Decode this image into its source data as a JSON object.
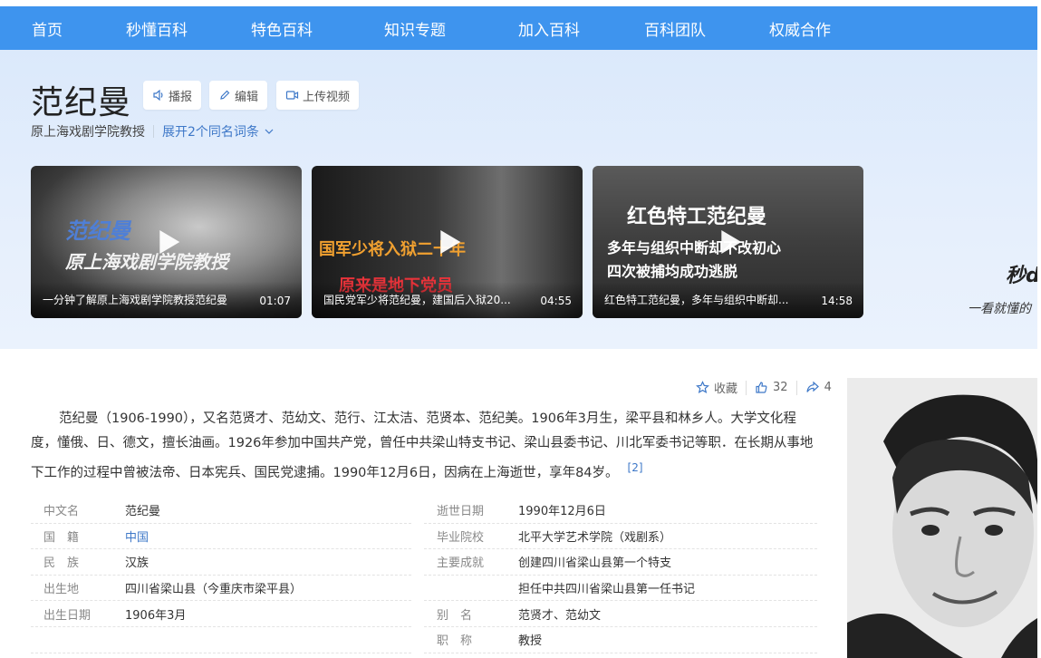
{
  "nav": {
    "items": [
      "首页",
      "秒懂百科",
      "特色百科",
      "知识专题",
      "加入百科",
      "百科团队",
      "权威合作"
    ]
  },
  "header": {
    "title": "范纪曼",
    "actions": {
      "broadcast": "播报",
      "edit": "编辑",
      "upload_video": "上传视频"
    },
    "subtitle": "原上海戏剧学院教授",
    "expand_label": "展开2个同名词条"
  },
  "videos": [
    {
      "overlay_line1": "范纪曼",
      "overlay_line2": "原上海戏剧学院教授",
      "caption": "一分钟了解原上海戏剧学院教授范纪曼",
      "duration": "01:07"
    },
    {
      "overlay_line1": "国军少将入狱二十年",
      "overlay_line2": "原来是地下党员",
      "caption": "国民党军少将范纪曼，建国后入狱20...",
      "duration": "04:55"
    },
    {
      "overlay_line1": "红色特工范纪曼",
      "overlay_line2": "多年与组织中断却不改初心",
      "overlay_line3": "四次被捕均成功逃脱",
      "caption": "红色特工范纪曼，多年与组织中断却...",
      "duration": "14:58"
    }
  ],
  "promo": {
    "line1": "秒d",
    "line2": "一看就懂的"
  },
  "stats": {
    "favorite": "收藏",
    "likes": "32",
    "shares": "4"
  },
  "summary": {
    "text": "范纪曼（1906-1990），又名范贤才、范幼文、范行、江太洁、范贤本、范纪美。1906年3月生，梁平县和林乡人。大学文化程度，懂俄、日、德文，擅长油画。1926年参加中国共产党，曾任中共梁山特支书记、梁山县委书记、川北军委书记等职．在长期从事地下工作的过程中曾被法帝、日本宪兵、国民党逮捕。1990年12月6日，因病在上海逝世，享年84岁。",
    "ref": "[2]"
  },
  "infobox": {
    "left": [
      {
        "key": "中文名",
        "value": "范纪曼"
      },
      {
        "key": "国　籍",
        "value": "中国"
      },
      {
        "key": "民　族",
        "value": "汉族"
      },
      {
        "key": "出生地",
        "value": "四川省梁山县（今重庆市梁平县）"
      },
      {
        "key": "出生日期",
        "value": "1906年3月"
      }
    ],
    "right": [
      {
        "key": "逝世日期",
        "value": "1990年12月6日"
      },
      {
        "key": "毕业院校",
        "value": "北平大学艺术学院（戏剧系）"
      },
      {
        "key": "主要成就",
        "value": "创建四川省梁山县第一个特支"
      },
      {
        "key": "",
        "value": "担任中共四川省梁山县第一任书记"
      },
      {
        "key": "别　名",
        "value": "范贤才、范幼文"
      },
      {
        "key": "职　称",
        "value": "教授"
      }
    ]
  },
  "colors": {
    "nav_bg": "#3e94ee",
    "link": "#3e78c8",
    "hero_bg": "#dbe9fb"
  }
}
